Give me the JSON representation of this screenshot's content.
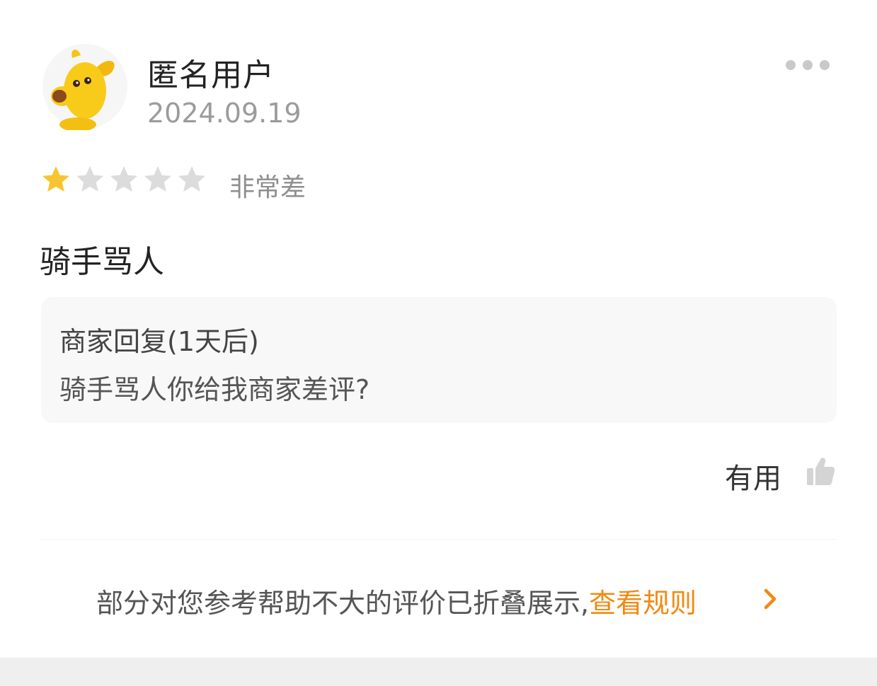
{
  "review": {
    "user_name": "匿名用户",
    "date": "2024.09.19",
    "rating": 1,
    "rating_max": 5,
    "rating_label": "非常差",
    "text": "骑手骂人"
  },
  "merchant_reply": {
    "title": "商家回复(1天后)",
    "text": "骑手骂人你给我商家差评?"
  },
  "actions": {
    "useful_label": "有用"
  },
  "footer": {
    "notice": "部分对您参考帮助不大的评价已折叠展示,",
    "link_label": "查看规则"
  },
  "icons": {
    "avatar": "yellow-dog-avatar",
    "more": "more-dots-icon",
    "thumb": "thumbs-up-icon",
    "chevron": "chevron-right-icon"
  },
  "colors": {
    "star_filled": "#f7c531",
    "star_empty": "#dcdcdc",
    "link": "#f08a12"
  }
}
